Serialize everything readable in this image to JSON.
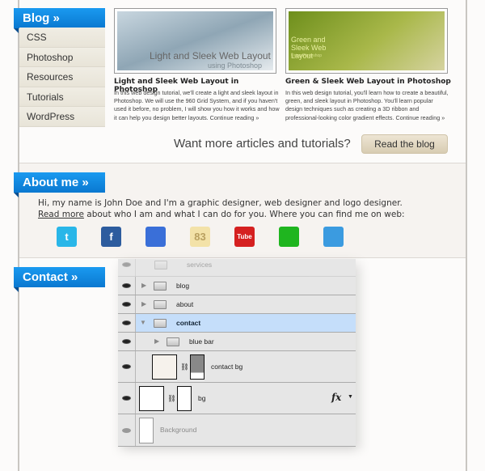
{
  "blog": {
    "tab": "Blog »",
    "categories": [
      "CSS",
      "Photoshop",
      "Resources",
      "Tutorials",
      "WordPress"
    ],
    "articles": [
      {
        "thumb_caption": "Light and Sleek Web Layout",
        "thumb_sub": "using Photoshop",
        "title": "Light and Sleek Web Layout in Photoshop",
        "desc": "In this web design tutorial, we'll create a light and sleek layout in Photoshop. We will use the 960 Grid System, and if you haven't used it before, no problem, I will show you how it works and how it can help you design better layouts.",
        "more": "Continue reading »"
      },
      {
        "thumb_caption": "Green and Sleek Web Layout",
        "thumb_sub": "Using Photoshop",
        "title": "Green & Sleek Web Layout in Photoshop",
        "desc": "In this web design tutorial, you'll learn how to create a beautiful, green, and sleek layout in Photoshop. You'll learn popular design techniques such as creating a 3D ribbon and professional-looking color gradient effects.",
        "more": "Continue reading »"
      }
    ],
    "more_text": "Want more articles and tutorials?",
    "button": "Read the blog"
  },
  "about": {
    "tab": "About me »",
    "line1": "Hi, my name is John Doe and I'm a graphic designer, web designer and logo designer.",
    "link": "Read more",
    "line2": " about who I am and what I can do for you. Where you can find me on web:",
    "icons": [
      {
        "name": "twitter-icon",
        "glyph": "t",
        "color": "#29b6e8"
      },
      {
        "name": "facebook-icon",
        "glyph": "f",
        "color": "#2d5c9e"
      },
      {
        "name": "delicious-icon",
        "glyph": "",
        "color": "#3a6fd8"
      },
      {
        "name": "blogger-icon",
        "glyph": "83",
        "color": "#f3e2a8"
      },
      {
        "name": "youtube-icon",
        "glyph": "Tube",
        "color": "#d52020"
      },
      {
        "name": "technorati-icon",
        "glyph": "",
        "color": "#1fb51f"
      },
      {
        "name": "flickr-icon",
        "glyph": "",
        "color": "#3b9be0"
      }
    ]
  },
  "contact": {
    "tab": "Contact »",
    "layers": [
      "services",
      "blog",
      "about",
      "contact",
      "blue bar",
      "contact bg",
      "bg",
      "Background"
    ],
    "fx": "fx",
    "accent": "#c5defa"
  }
}
